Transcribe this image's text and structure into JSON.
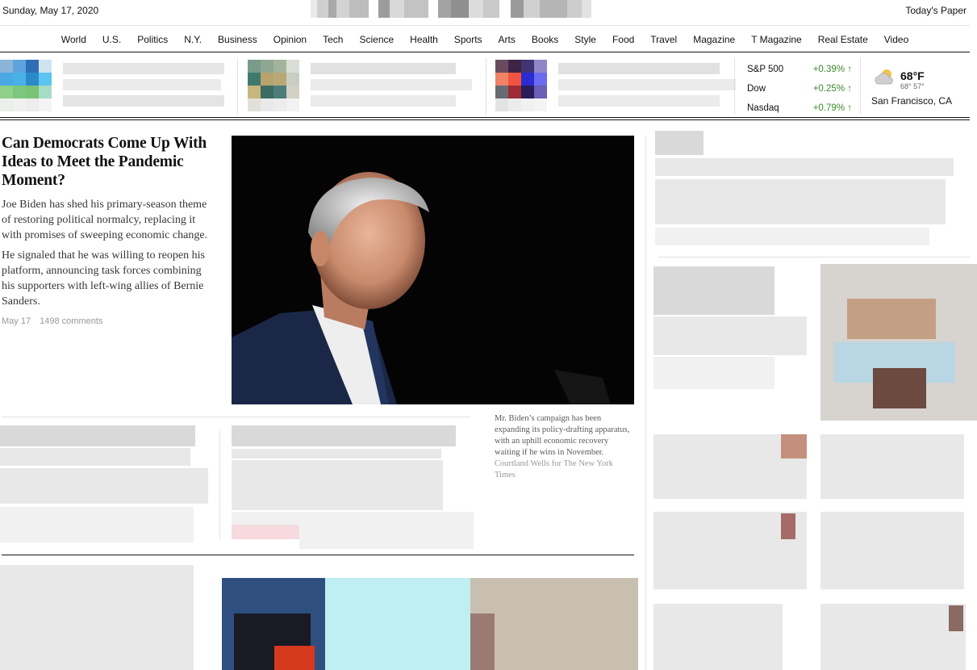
{
  "header": {
    "date": "Sunday, May 17, 2020",
    "todays_paper": "Today's Paper"
  },
  "nav": {
    "items": [
      "World",
      "U.S.",
      "Politics",
      "N.Y.",
      "Business",
      "Opinion",
      "Tech",
      "Science",
      "Health",
      "Sports",
      "Arts",
      "Books",
      "Style",
      "Food",
      "Travel",
      "Magazine",
      "T Magazine",
      "Real Estate",
      "Video"
    ]
  },
  "markets": [
    {
      "name": "S&P 500",
      "change": "+0.39%",
      "arrow": "↑"
    },
    {
      "name": "Dow",
      "change": "+0.25%",
      "arrow": "↑"
    },
    {
      "name": "Nasdaq",
      "change": "+0.79%",
      "arrow": "↑"
    }
  ],
  "weather": {
    "temp": "68°F",
    "hilo": "68° 57°",
    "location": "San Francisco, CA",
    "icon": "partly-cloudy-icon"
  },
  "lead": {
    "headline": "Can Democrats Come Up With Ideas to Meet the Pandemic Moment?",
    "summary_1": "Joe Biden has shed his primary-season theme of restoring political normalcy, replacing it with promises of sweeping economic change.",
    "summary_2": "He signaled that he was willing to reopen his platform, announcing task forces combining his supporters with left-wing allies of Bernie Sanders.",
    "date": "May 17",
    "comments": "1498 comments",
    "caption": "Mr. Biden’s campaign has been expanding its policy-drafting apparatus, with an uphill economic recovery waiting if he wins in November.",
    "credit": "Courtland Wells for The New York Times"
  },
  "colors": {
    "market_up": "#3a8b2c",
    "rule": "#121212",
    "photo_bg": "#050506"
  }
}
